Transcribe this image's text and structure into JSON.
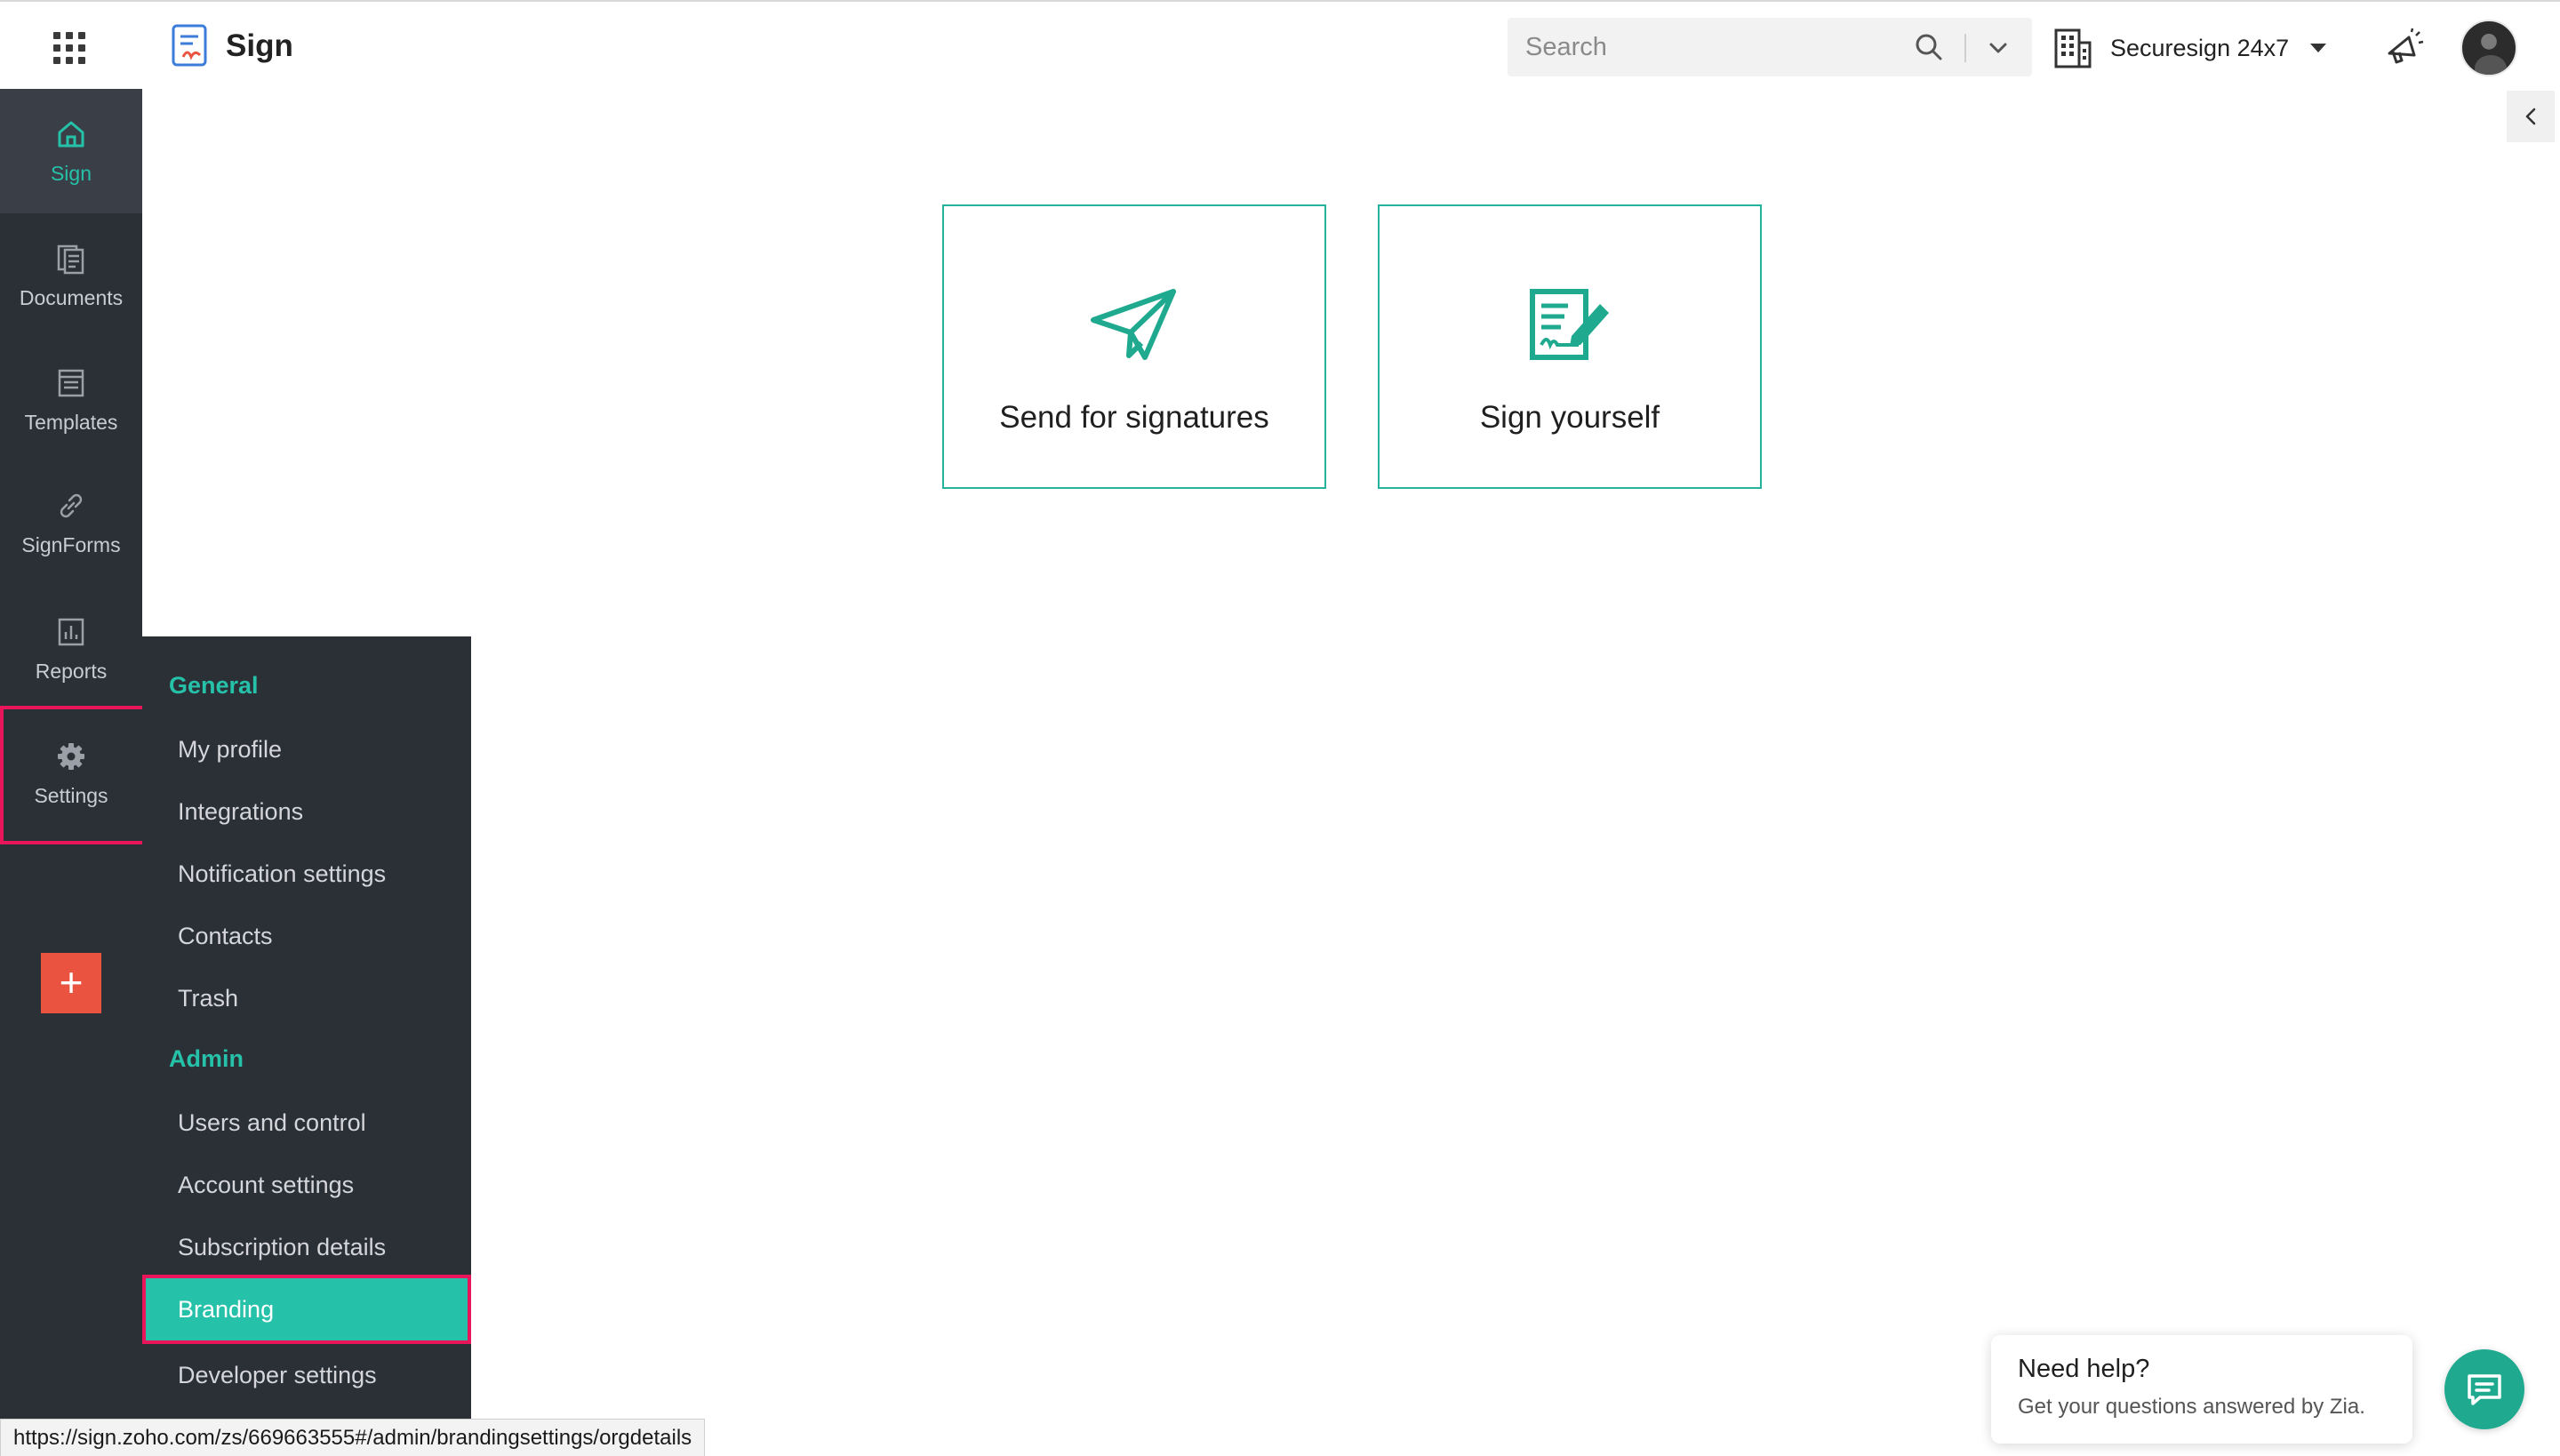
{
  "app": {
    "name": "Sign",
    "icons": {
      "apps": "apps-grid-icon",
      "logo": "sign-logo-icon"
    }
  },
  "header": {
    "search_placeholder": "Search",
    "org_name": "Securesign 24x7",
    "icons": [
      "search-icon",
      "chevron-down-icon",
      "building-icon",
      "caret-down-icon",
      "megaphone-icon",
      "avatar"
    ]
  },
  "nav": {
    "items": [
      {
        "label": "Sign",
        "icon": "home-icon",
        "active": true
      },
      {
        "label": "Documents",
        "icon": "documents-icon"
      },
      {
        "label": "Templates",
        "icon": "templates-icon"
      },
      {
        "label": "SignForms",
        "icon": "link-icon"
      },
      {
        "label": "Reports",
        "icon": "reports-icon"
      },
      {
        "label": "Settings",
        "icon": "gear-icon",
        "highlighted": true
      }
    ],
    "add_label": "+"
  },
  "settings_menu": {
    "general_heading": "General",
    "general_items": [
      "My profile",
      "Integrations",
      "Notification settings",
      "Contacts",
      "Trash"
    ],
    "admin_heading": "Admin",
    "admin_items": [
      "Users and control",
      "Account settings",
      "Subscription details",
      "Branding",
      "Developer settings"
    ],
    "active_item": "Branding"
  },
  "main": {
    "cards": [
      {
        "label": "Send for signatures",
        "icon": "paper-plane-icon"
      },
      {
        "label": "Sign yourself",
        "icon": "sign-document-icon"
      }
    ]
  },
  "status_url": "https://sign.zoho.com/zs/669663555#/admin/brandingsettings/orgdetails",
  "help": {
    "title": "Need help?",
    "subtitle": "Get your questions answered by Zia."
  },
  "colors": {
    "accent": "#26c1a9",
    "nav_bg": "#2b2f36",
    "highlight": "#e8155b",
    "add_button": "#e9533f"
  }
}
